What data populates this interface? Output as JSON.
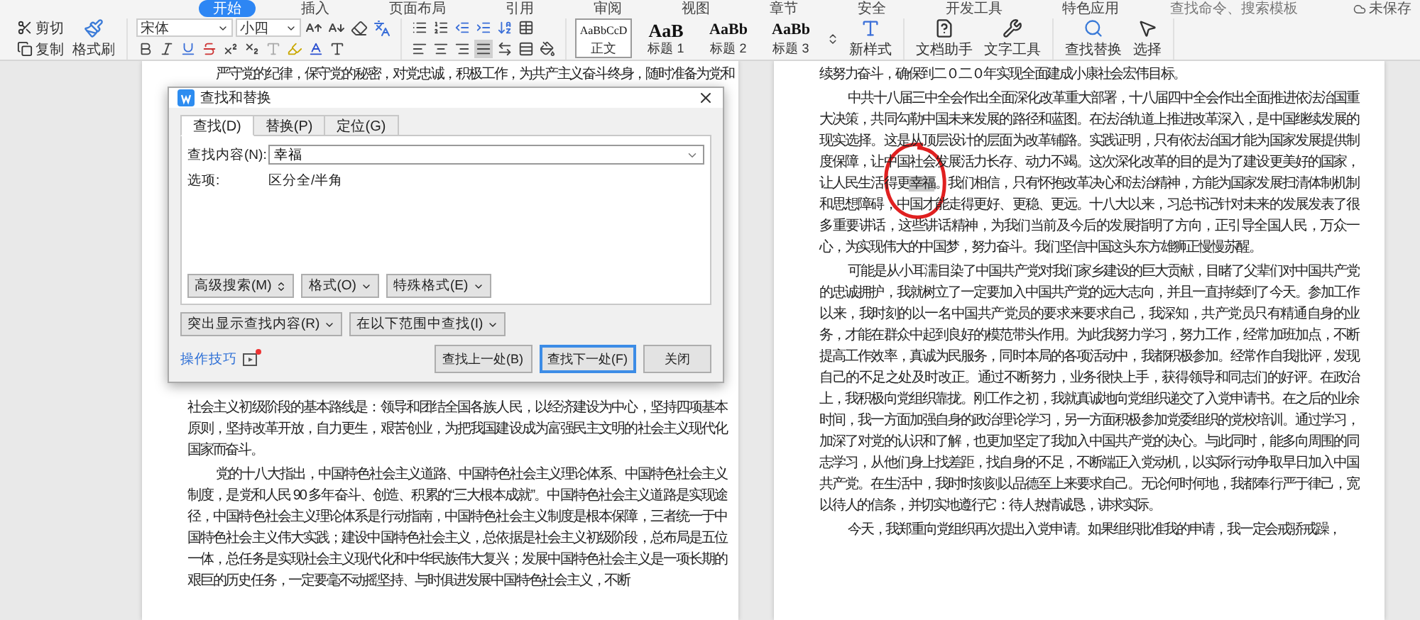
{
  "menu_tabs": [
    {
      "label": "开始",
      "selected": true
    },
    {
      "label": "插入",
      "selected": false
    },
    {
      "label": "页面布局",
      "selected": false
    },
    {
      "label": "引用",
      "selected": false
    },
    {
      "label": "审阅",
      "selected": false
    },
    {
      "label": "视图",
      "selected": false
    },
    {
      "label": "章节",
      "selected": false
    },
    {
      "label": "安全",
      "selected": false
    },
    {
      "label": "开发工具",
      "selected": false
    },
    {
      "label": "特色应用",
      "selected": false
    }
  ],
  "command_search": {
    "placeholder": "查找命令、搜索模板"
  },
  "save_status": "未保存",
  "ribbon": {
    "cut": "剪切",
    "copy": "复制",
    "format_painter": "格式刷",
    "font": "宋体",
    "font_size": "小四",
    "align_buttons": [
      {
        "selected": false
      },
      {
        "selected": false
      },
      {
        "selected": false
      },
      {
        "selected": true
      },
      {
        "selected": false
      }
    ],
    "styles": [
      {
        "preview": "AaBbCcD",
        "label": "正文",
        "selected": true
      },
      {
        "preview": "AaB",
        "label": "标题 1",
        "selected": false
      },
      {
        "preview": "AaBb",
        "label": "标题 2",
        "selected": false
      },
      {
        "preview": "AaBb",
        "label": "标题 3",
        "selected": false
      }
    ],
    "new_style": "新样式",
    "doc_assistant": "文档助手",
    "text_tools": "文字工具",
    "find_replace": "查找替换",
    "select": "选择"
  },
  "left_page": {
    "top_paragraphs": [
      {
        "text": "严守党的纪律，保守党的秘密，对党忠诚，积极工作，为共产主义奋斗终身，随时准备为党和",
        "indent": true
      }
    ],
    "paragraphs": [
      {
        "text": "社会主义初级阶段的基本路线是：领导和团结全国各族人民，以经济建设为中心，坚持四项基本原则，坚持改革开放，自力更生，艰苦创业，为把我国建设成为富强民主文明的社会主义现代化国家而奋斗。",
        "indent": false
      },
      {
        "text": "党的十八大指出，中国特色社会主义道路、中国特色社会主义理论体系、中国特色社会主义制度，是党和人民 90 多年奋斗、创造、积累的“三大根本成就”。中国特色社会主义道路是实现途径，中国特色社会主义理论体系是行动指南，中国特色社会主义制度是根本保障，三者统一于中国特色社会主义伟大实践；建设中国特色社会主义，总依据是社会主义初级阶段，总布局是五位一体，总任务是实现社会主义现代化和中华民族伟大复兴；发展中国特色社会主义是一项长期的艰巨的历史任务，一定要毫不动摇坚持、与时俱进发展中国特色社会主义，不断",
        "indent": true
      }
    ]
  },
  "right_page": {
    "paragraphs": [
      {
        "text": "续努力奋斗，确保到二０二０年实现全面建成小康社会宏伟目标。",
        "indent": false
      },
      {
        "segments": [
          {
            "text": "中共十八届三中全会作出全面深化改革重大部署，十八届四中全会作出全面推进依法治国重大决策，共同勾勒中国未来发展的路径和蓝图。在法治轨道上推进改革深入，是中国继续发展的现实选择。这是从顶层设计的层面为改革铺路。实践证明，只有依法治国才能为国家发展提供制度保障，让中国社会发展活力长存、动力不竭。这次深化改革的目的是为了建设更美好的国家，让人民生活得更",
            "highlighted": false
          },
          {
            "text": "幸福",
            "highlighted": true
          },
          {
            "text": "。我们相信，只有怀抱改革决心和法治精神，方能为国家发展扫清体制机制和思想障碍，中国才能走得更好、更稳、更远。十八大以来，习总书记针对未来的发展发表了很多重要讲话，这些讲话精神，为我们当前及今后的发展指明了方向，正引导全国人民，万众一心，为实现伟大的中国梦，努力奋斗。我们坚信中国这头东方雄狮正慢慢苏醒。",
            "highlighted": false
          }
        ],
        "indent": true
      },
      {
        "text": "可能是从小耳濡目染了中国共产党对我们家乡建设的巨大贡献，目睹了父辈们对中国共产党的忠诚拥护，我就树立了一定要加入中国共产党的远大志向，并且一直持续到了今天。参加工作以来，我时刻的以一名中国共产党员的要求来要求自己，我深知，共产党员只有精通自身的业务，才能在群众中起到良好的模范带头作用。为此我努力学习，努力工作，经常加班加点，不断提高工作效率，真诚为民服务，同时本局的各项活动中，我都积极参加。经常作自我批评，发现自己的不足之处及时改正。通过不断努力，业务很快上手，获得领导和同志们的好评。在政治上，我积极向党组织靠拢。刚工作之初，我就真诚地向党组织递交了入党申请书。在之后的业余时间，我一方面加强自身的政治理论学习，另一方面积极参加党委组织的党校培训。通过学习，加深了对党的认识和了解，也更加坚定了我加入中国共产党的决心。与此同时，能多向周围的同志学习，从他们身上找差距，找自身的不足，不断端正入党动机，以实际行动争取早日加入中国共产党。在生活中，我时时刻刻以品德至上来要求自己。无论何时何地，我都奉行严于律己，宽以待人的信条，并切实地遵行它：待人热情诚恳，讲求实际。",
        "indent": true
      },
      {
        "text": "今天，我郑重向党组织再次提出入党申请。如果组织批准我的申请，我一定会戒骄戒躁，",
        "indent": true
      }
    ]
  },
  "dialog": {
    "title": "查找和替换",
    "tabs": [
      {
        "label": "查找(D)",
        "selected": true
      },
      {
        "label": "替换(P)",
        "selected": false
      },
      {
        "label": "定位(G)",
        "selected": false
      }
    ],
    "find_label": "查找内容(N):",
    "find_value": "幸福",
    "options_label": "选项:",
    "options_value": "区分全/半角",
    "option_buttons": [
      {
        "label": "高级搜索(M)",
        "kind": "expand"
      },
      {
        "label": "格式(O)",
        "kind": "menu"
      },
      {
        "label": "特殊格式(E)",
        "kind": "menu"
      }
    ],
    "scope_buttons": [
      {
        "label": "突出显示查找内容(R)"
      },
      {
        "label": "在以下范围中查找(I)"
      }
    ],
    "tips_link": "操作技巧",
    "tips_badge": true,
    "action_buttons": [
      {
        "label": "查找上一处(B)",
        "focused": false
      },
      {
        "label": "查找下一处(F)",
        "focused": true
      },
      {
        "label": "关闭",
        "focused": false
      }
    ]
  }
}
